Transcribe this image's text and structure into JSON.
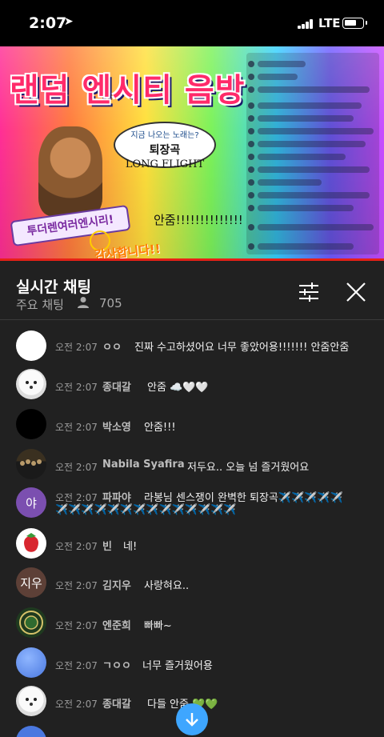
{
  "status_bar": {
    "time": "2:07",
    "network": "LTE"
  },
  "video": {
    "title": "랜덤 엔시티 음방",
    "bubble_question": "지금 나오는 노래는?",
    "song_korean": "퇴장곡",
    "song_english": "LONG FLIGHT",
    "banner": "투더렌여러엔시리!",
    "thanks": "감사합니다!!",
    "farewell": "안줌!!!!!!!!!!!!!!"
  },
  "chat_header": {
    "title": "실시간 채팅",
    "mode": "주요 채팅",
    "viewer_count": "705"
  },
  "messages": [
    {
      "time": "오전 2:07",
      "author": "ㅇㅇ",
      "text": "진짜 수고하셨어요 너무 좋았어용!!!!!!! 안줌안줌",
      "avatar": "white"
    },
    {
      "time": "오전 2:07",
      "author": "종대갈",
      "text": "안줌 ☁️🤍🤍",
      "avatar": "dog"
    },
    {
      "time": "오전 2:07",
      "author": "박소영",
      "text": "안줌!!!",
      "avatar": "black"
    },
    {
      "time": "오전 2:07",
      "author": "Nabila Syafira",
      "text": "저두요.. 오늘 넘 즐거웠어요",
      "avatar": "group"
    },
    {
      "time": "오전 2:07",
      "author": "파파야",
      "text": "라봉님 센스쟁이 완벽한 퇴장곡✈️✈️✈️✈️✈️",
      "text2": "✈️✈️✈️✈️✈️✈️✈️✈️✈️✈️✈️✈️✈️✈️",
      "avatar": "야"
    },
    {
      "time": "오전 2:07",
      "author": "빈",
      "text": "네!",
      "avatar": "strawberry"
    },
    {
      "time": "오전 2:07",
      "author": "김지우",
      "text": "사랑혀요..",
      "avatar": "지우"
    },
    {
      "time": "오전 2:07",
      "author": "엔준희",
      "text": "빠빠~",
      "avatar": "badge"
    },
    {
      "time": "오전 2:07",
      "author": "ㄱㅇㅇ",
      "text": "너무 즐거웠어용",
      "avatar": "blue"
    },
    {
      "time": "오전 2:07",
      "author": "종대갈",
      "text": "다들 안줌 💚💚",
      "avatar": "dog"
    }
  ],
  "colors": {
    "accent": "#3ea6ff",
    "background": "#212121",
    "progress": "#e62117"
  }
}
